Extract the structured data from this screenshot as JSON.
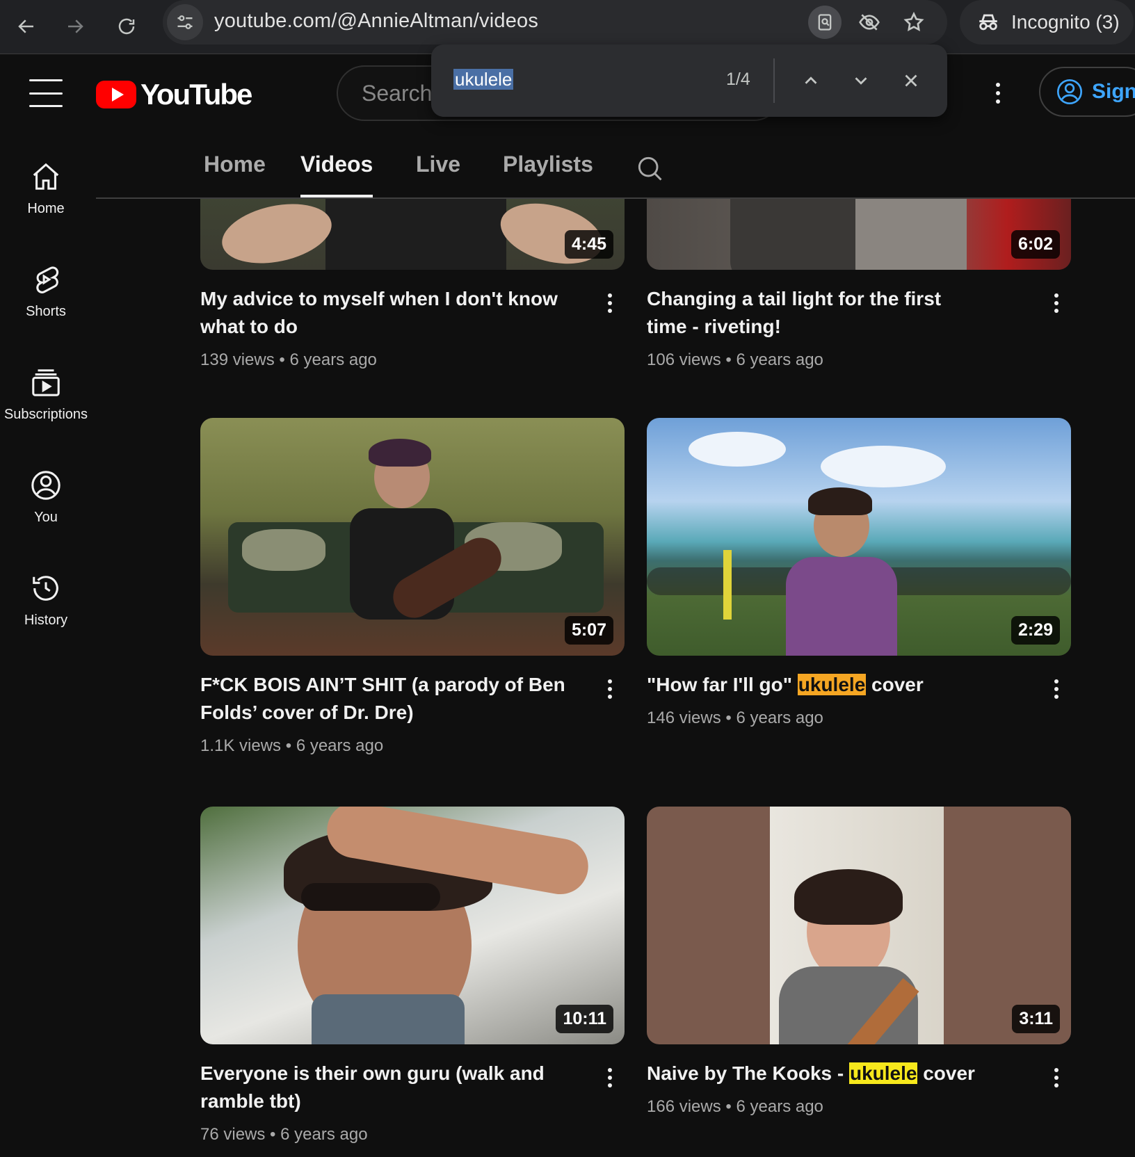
{
  "browser": {
    "url": "youtube.com/@AnnieAltman/videos",
    "incognito_label": "Incognito (3)"
  },
  "find_bar": {
    "query": "ukulele",
    "count": "1/4"
  },
  "masthead": {
    "logo_text": "YouTube",
    "search_placeholder": "Search",
    "sign_in_label": "Sign"
  },
  "sidebar": {
    "items": [
      {
        "label": "Home",
        "icon": "home-icon"
      },
      {
        "label": "Shorts",
        "icon": "shorts-icon"
      },
      {
        "label": "Subscriptions",
        "icon": "subscriptions-icon"
      },
      {
        "label": "You",
        "icon": "you-icon"
      },
      {
        "label": "History",
        "icon": "history-icon"
      }
    ]
  },
  "tabs": [
    "Home",
    "Videos",
    "Live",
    "Playlists"
  ],
  "active_tab": "Videos",
  "videos": [
    {
      "title": "My advice to myself when I don't know what to do",
      "views": "139 views",
      "age": "6 years ago",
      "duration": "4:45"
    },
    {
      "title": "Changing a tail light for the first time - riveting!",
      "views": "106 views",
      "age": "6 years ago",
      "duration": "6:02"
    },
    {
      "title": "F*CK BOIS AIN’T SHIT (a parody of Ben Folds’ cover of Dr. Dre)",
      "views": "1.1K views",
      "age": "6 years ago",
      "duration": "5:07"
    },
    {
      "title_before": "\"How far I'll go\" ",
      "title_highlight": "ukulele",
      "title_after": " cover",
      "views": "146 views",
      "age": "6 years ago",
      "duration": "2:29"
    },
    {
      "title": "Everyone is their own guru (walk and ramble tbt)",
      "views": "76 views",
      "age": "6 years ago",
      "duration": "10:11"
    },
    {
      "title_before": "Naive by The Kooks - ",
      "title_highlight": "ukulele",
      "title_after": " cover",
      "views": "166 views",
      "age": "6 years ago",
      "duration": "3:11"
    }
  ],
  "meta_separator": "•",
  "colors": {
    "background": "#0f0f0f",
    "brand_red": "#ff0000",
    "find_match": "#f5a623",
    "find_current": "#f7e81c",
    "link_blue": "#3ea6ff"
  }
}
